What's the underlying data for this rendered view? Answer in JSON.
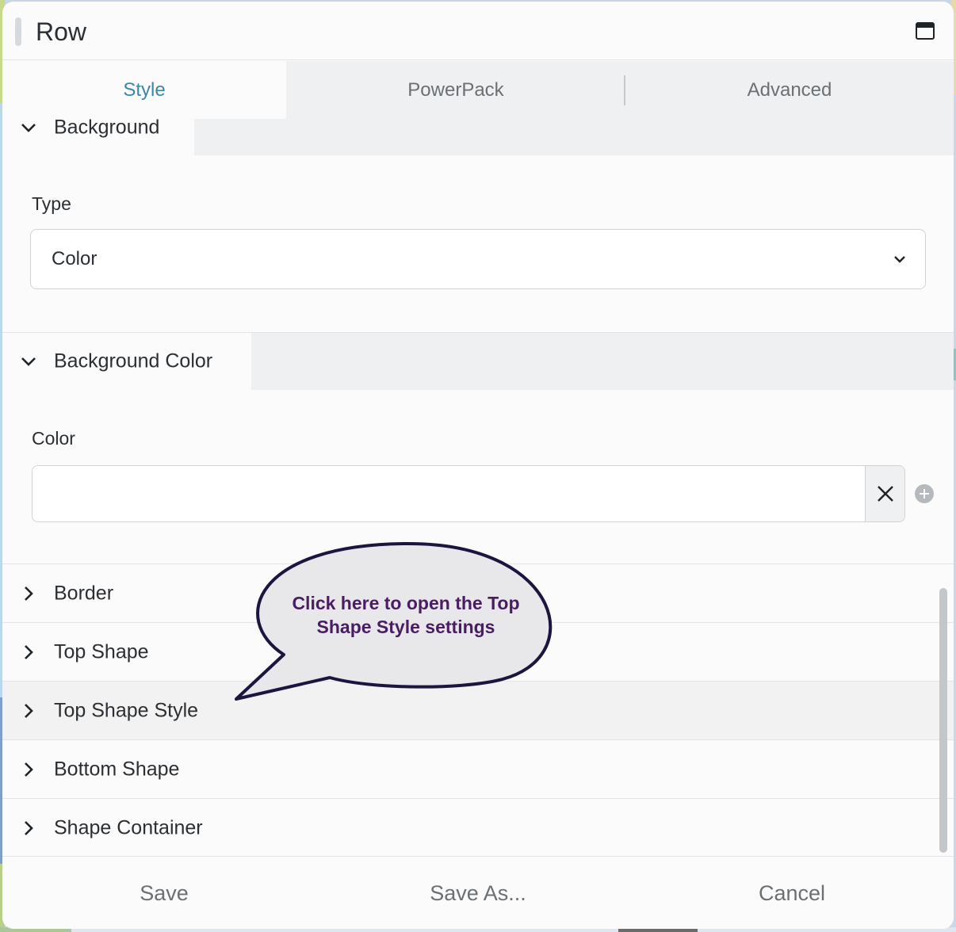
{
  "window": {
    "title": "Row",
    "icon": "window-maximize-icon"
  },
  "tabs": [
    {
      "label": "Style",
      "active": true
    },
    {
      "label": "PowerPack",
      "active": false
    },
    {
      "label": "Advanced",
      "active": false
    }
  ],
  "sections": {
    "background": {
      "title": "Background",
      "expanded": true,
      "type_label": "Type",
      "type_value": "Color"
    },
    "background_color": {
      "title": "Background Color",
      "expanded": true,
      "color_label": "Color",
      "color_value": ""
    },
    "collapsed": [
      {
        "label": "Border"
      },
      {
        "label": "Top Shape"
      },
      {
        "label": "Top Shape Style",
        "highlighted": true
      },
      {
        "label": "Bottom Shape"
      },
      {
        "label": "Shape Container"
      }
    ]
  },
  "callout": {
    "text": "Click here to open the Top Shape Style settings"
  },
  "footer": {
    "save": "Save",
    "save_as": "Save As...",
    "cancel": "Cancel"
  },
  "colors": {
    "accent": "#3a87a6",
    "callout_text": "#4a1c64",
    "callout_fill": "#e8e8ea",
    "callout_border": "#1b1640"
  }
}
